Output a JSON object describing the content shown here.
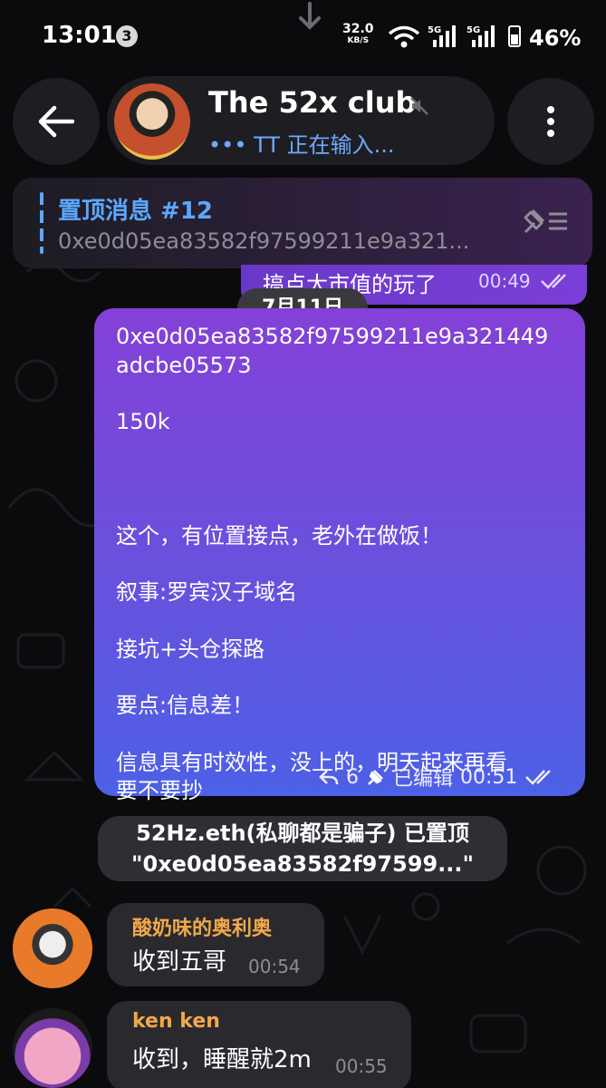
{
  "status_bar": {
    "time": "13:01",
    "notification_count": "3",
    "net_speed": "32.0",
    "net_unit": "KB/S",
    "sim1": "5G",
    "sim2": "5G",
    "battery": "46%"
  },
  "header": {
    "title": "The 52x club",
    "typing": "••• TT 正在输入..."
  },
  "pinned": {
    "title": "置顶消息 #12",
    "text": "0xe0d05ea83582f97599211e9a321..."
  },
  "previous_message": {
    "text": "搞点大市值的玩了",
    "time": "00:49"
  },
  "date_chip": "7月11日",
  "main_message": {
    "paragraphs": [
      "0xe0d05ea83582f97599211e9a321449\nadcbe05573",
      "150k",
      "",
      "这个，有位置接点，老外在做饭！",
      "叙事:罗宾汉子域名",
      "接坑+头仓探路",
      "要点:信息差！",
      "信息具有时效性，没上的，明天起来再看\n要不要抄"
    ],
    "reply_count": "6",
    "edited_label": "已编辑",
    "time": "00:51"
  },
  "service_message": {
    "line1": "52Hz.eth(私聊都是骗子) 已置顶",
    "line2": "\"0xe0d05ea83582f97599...\""
  },
  "incoming": [
    {
      "name": "酸奶味的奥利奥",
      "text": "收到五哥",
      "time": "00:54"
    },
    {
      "name": "ken ken",
      "text": "收到，睡醒就2m",
      "time": "00:55"
    }
  ]
}
